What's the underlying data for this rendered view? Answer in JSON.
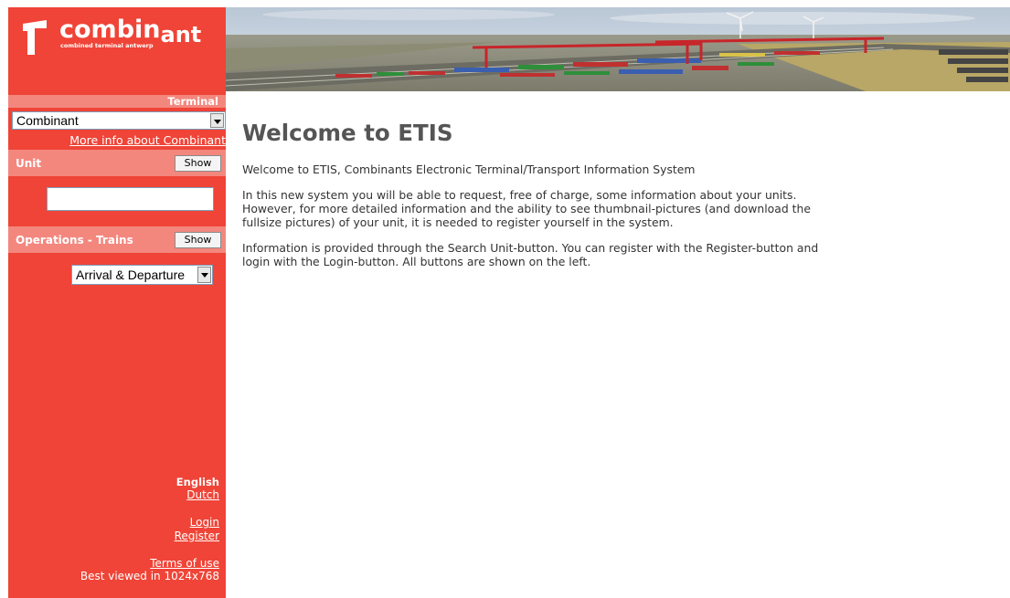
{
  "brand": {
    "name_part1": "combin",
    "name_part2": "ant",
    "tagline": "combined terminal antwerp"
  },
  "sidebar": {
    "terminal_label": "Terminal",
    "terminal_selected": "Combinant",
    "more_info_link": "More info about Combinant",
    "unit_label": "Unit",
    "unit_show_label": "Show",
    "unit_input_value": "",
    "operations_label": "Operations - Trains",
    "operations_show_label": "Show",
    "operations_selected": "Arrival & Departure",
    "language_current": "English",
    "language_alt": "Dutch",
    "login_link": "Login",
    "register_link": "Register",
    "terms_link": "Terms of use",
    "best_viewed": "Best viewed in 1024x768"
  },
  "main": {
    "title": "Welcome to ETIS",
    "paragraph1": "Welcome to ETIS, Combinants Electronic Terminal/Transport Information System",
    "paragraph2_lines": [
      "In this new system you will be able to request, free of charge, some information about your units.",
      "However, for more detailed information and the ability to see thumbnail-pictures (and download the",
      "fullsize pictures) of your unit, it is needed to register yourself in the system."
    ],
    "paragraph3_lines": [
      "Information is provided through the Search Unit-button.  You can register with the Register-button and",
      "login with the Login-button.  All buttons are shown on the left."
    ]
  },
  "colors": {
    "sidebar_bg": "#ef4437",
    "band_bg": "#f3877e",
    "title_color": "#555555"
  }
}
